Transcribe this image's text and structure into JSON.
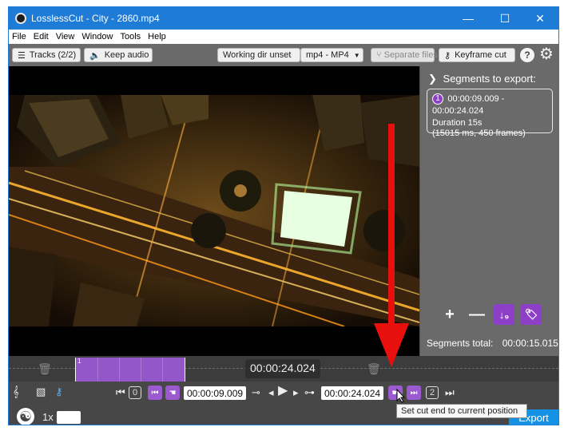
{
  "window": {
    "title": "LosslessCut - City - 2860.mp4",
    "controls": {
      "minimize": "—",
      "maximize": "☐",
      "close": "✕"
    }
  },
  "menu": [
    "File",
    "Edit",
    "View",
    "Window",
    "Tools",
    "Help"
  ],
  "toolbar": {
    "tracks": "Tracks (2/2)",
    "keep_audio": "Keep audio",
    "working_dir": "Working dir unset",
    "format": "mp4 - MP4",
    "separate_files": "Separate files",
    "keyframe_cut": "Keyframe cut",
    "help_glyph": "?"
  },
  "segments_panel": {
    "heading": "Segments to export:",
    "segments": [
      {
        "number": "1",
        "range": "00:00:09.009 - 00:00:24.024",
        "duration": "Duration 15s",
        "details": "(15015 ms, 450 frames)"
      }
    ],
    "tools": {
      "add": "+",
      "remove": "—",
      "sort": "↓₉",
      "tag": "🏷"
    },
    "total_label": "Segments total:",
    "total_value": "00:00:15.015"
  },
  "timeline": {
    "current_time": "00:00:24.024",
    "segment_marker": "1",
    "segment_start_fraction": 0.12,
    "segment_end_fraction": 0.32
  },
  "controls": {
    "cut_start_time": "00:00:09.009",
    "cut_end_time": "00:00:24.024",
    "segment_left_index": "0",
    "segment_right_index": "2",
    "speed": "1x",
    "export_label": "Export",
    "tooltip": "Set cut end to current position"
  },
  "colors": {
    "titlebar": "#1e7bd6",
    "segment_purple": "#9457c9",
    "export_blue": "#1592e6",
    "arrow_red": "#e8100c"
  }
}
